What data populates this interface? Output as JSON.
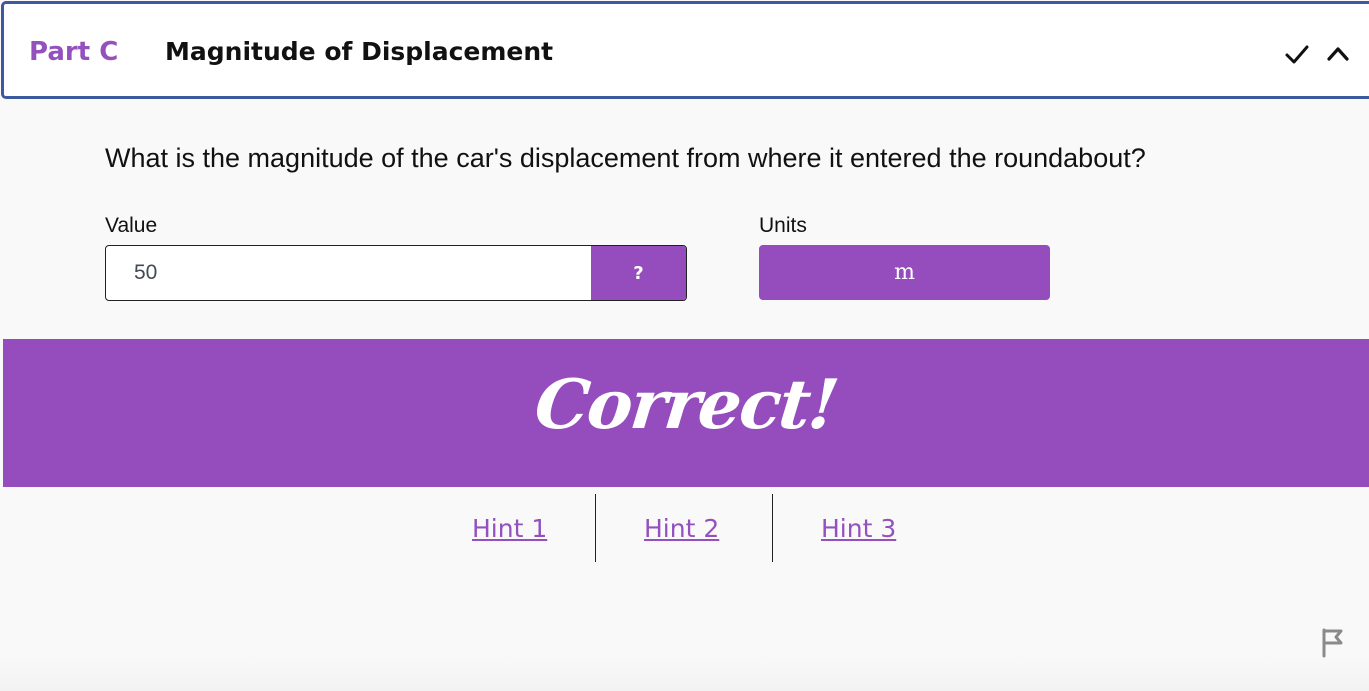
{
  "header": {
    "part_label": "Part C",
    "title": "Magnitude of Displacement",
    "status_icon": "check-icon",
    "toggle_icon": "chevron-up-icon"
  },
  "question": {
    "text": "What is the magnitude of the car's displacement from where it entered the roundabout?"
  },
  "answer": {
    "value_label": "Value",
    "value": "50",
    "help_label": "?",
    "units_label": "Units",
    "units_value": "m"
  },
  "feedback": {
    "message": "Correct!"
  },
  "hints": [
    {
      "label": "Hint 1"
    },
    {
      "label": "Hint 2"
    },
    {
      "label": "Hint 3"
    }
  ],
  "footer": {
    "flag_icon": "flag-icon"
  },
  "colors": {
    "accent": "#954dbe",
    "header_border": "#3d5a9e",
    "background": "#f9f9f9"
  }
}
